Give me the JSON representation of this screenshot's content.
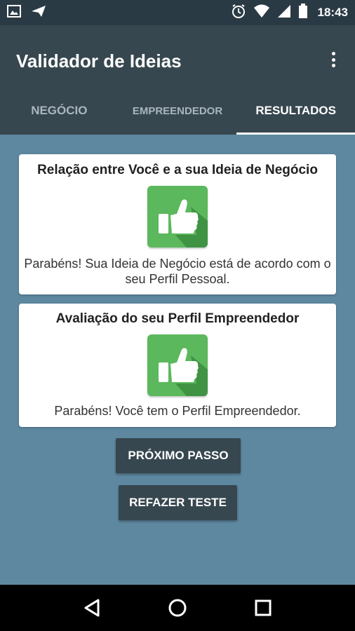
{
  "status_bar": {
    "time": "18:43",
    "icons": [
      "image-icon",
      "send-icon",
      "alarm-icon",
      "wifi-icon",
      "signal-icon",
      "battery-icon"
    ]
  },
  "app_bar": {
    "title": "Validador de Ideias",
    "menu_icon": "overflow-menu-icon"
  },
  "tabs": [
    {
      "label": "NEGÓCIO",
      "active": false
    },
    {
      "label": "EMPREENDEDOR",
      "active": false
    },
    {
      "label": "RESULTADOS",
      "active": true
    }
  ],
  "cards": [
    {
      "title": "Relação entre Você e a sua Ideia de Negócio",
      "icon": "thumbs-up-icon",
      "text": "Parabéns! Sua Ideia de Negócio está de acordo com o seu Perfil Pessoal."
    },
    {
      "title": "Avaliação do seu Perfil Empreendedor",
      "icon": "thumbs-up-icon",
      "text": "Parabéns! Você tem o Perfil Empreendedor."
    }
  ],
  "buttons": {
    "next": "PRÓXIMO PASSO",
    "redo": "REFAZER TESTE"
  },
  "nav_bar": {
    "icons": [
      "back-icon",
      "home-icon",
      "recents-icon"
    ]
  },
  "colors": {
    "app_bar": "#37474f",
    "status_bar": "#2a3a45",
    "background": "#5e88a0",
    "thumb_green": "#5bb85c",
    "card": "#ffffff"
  }
}
